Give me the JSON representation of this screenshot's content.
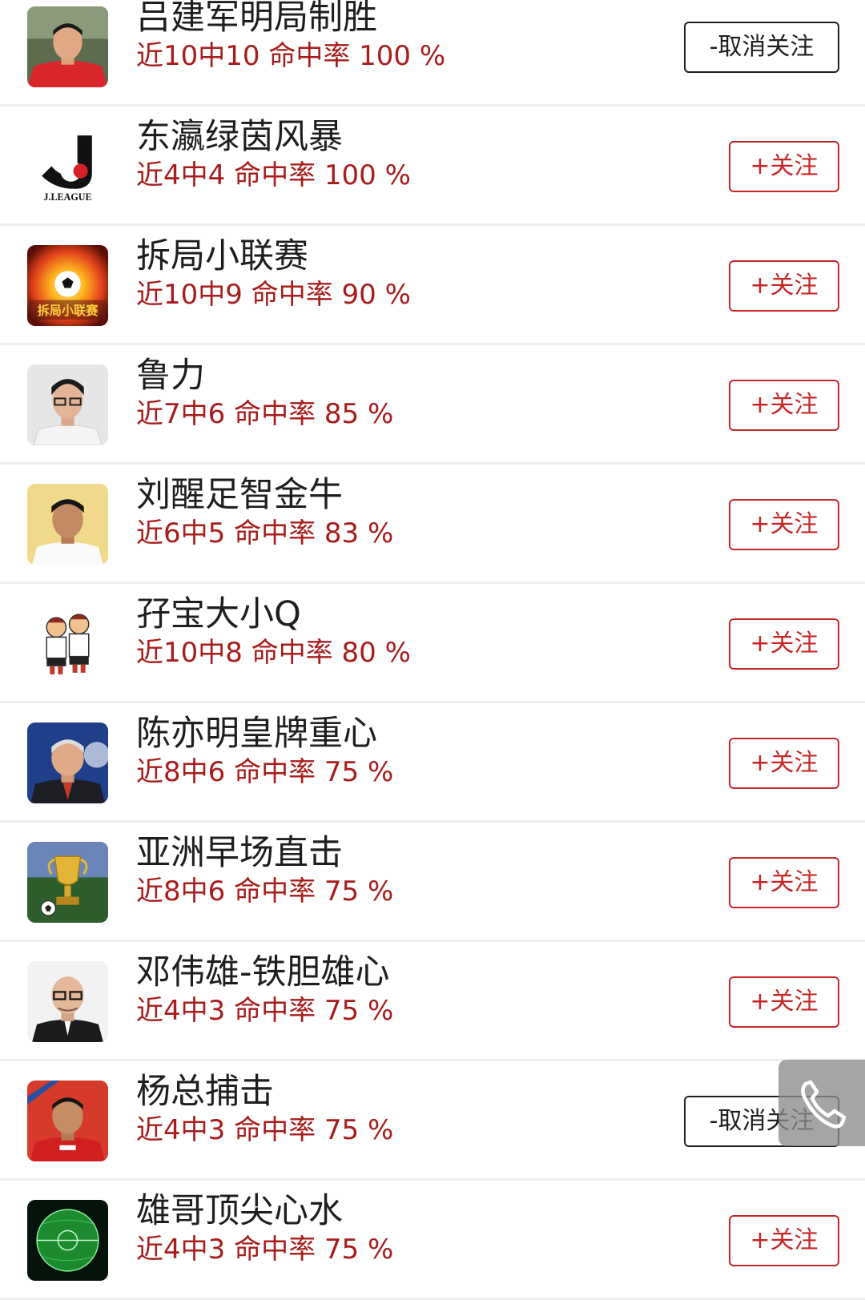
{
  "experts": [
    {
      "name": "吕建军明局制胜",
      "stat": "近10中10 命中率 100 %",
      "button": "-取消关注",
      "followed": true,
      "avatar": "portrait-red-shirt"
    },
    {
      "name": "东瀛绿茵风暴",
      "stat": "近4中4 命中率 100 %",
      "button": "+关注",
      "followed": false,
      "avatar": "jleague-logo",
      "avatar_text": "J.LEAGUE"
    },
    {
      "name": "拆局小联赛",
      "stat": "近10中9 命中率 90 %",
      "button": "+关注",
      "followed": false,
      "avatar": "fire-soccer-ball",
      "avatar_text": "拆局小联赛"
    },
    {
      "name": "鲁力",
      "stat": "近7中6 命中率 85 %",
      "button": "+关注",
      "followed": false,
      "avatar": "portrait-glasses"
    },
    {
      "name": "刘醒足智金牛",
      "stat": "近6中5 命中率 83 %",
      "button": "+关注",
      "followed": false,
      "avatar": "portrait-white-shirt"
    },
    {
      "name": "孖宝大小Q",
      "stat": "近10中8 命中率 80 %",
      "button": "+关注",
      "followed": false,
      "avatar": "cartoon-mascots"
    },
    {
      "name": "陈亦明皇牌重心",
      "stat": "近8中6 命中率 75 %",
      "button": "+关注",
      "followed": false,
      "avatar": "portrait-suit"
    },
    {
      "name": "亚洲早场直击",
      "stat": "近8中6 命中率 75 %",
      "button": "+关注",
      "followed": false,
      "avatar": "trophy-stadium"
    },
    {
      "name": "邓伟雄-铁胆雄心",
      "stat": "近4中3 命中率 75 %",
      "button": "+关注",
      "followed": false,
      "avatar": "portrait-bald-glasses"
    },
    {
      "name": "杨总捕击",
      "stat": "近4中3 命中率 75 %",
      "button": "-取消关注",
      "followed": true,
      "avatar": "portrait-red-jersey"
    },
    {
      "name": "雄哥顶尖心水",
      "stat": "近4中3 命中率 75 %",
      "button": "+关注",
      "followed": false,
      "avatar": "green-pitch-globe"
    }
  ],
  "floating_button": {
    "icon": "phone-icon"
  },
  "colors": {
    "accent": "#c72626",
    "stat_text": "#a81c1c",
    "name_text": "#1e1e1e",
    "divider": "#eeeeee"
  }
}
